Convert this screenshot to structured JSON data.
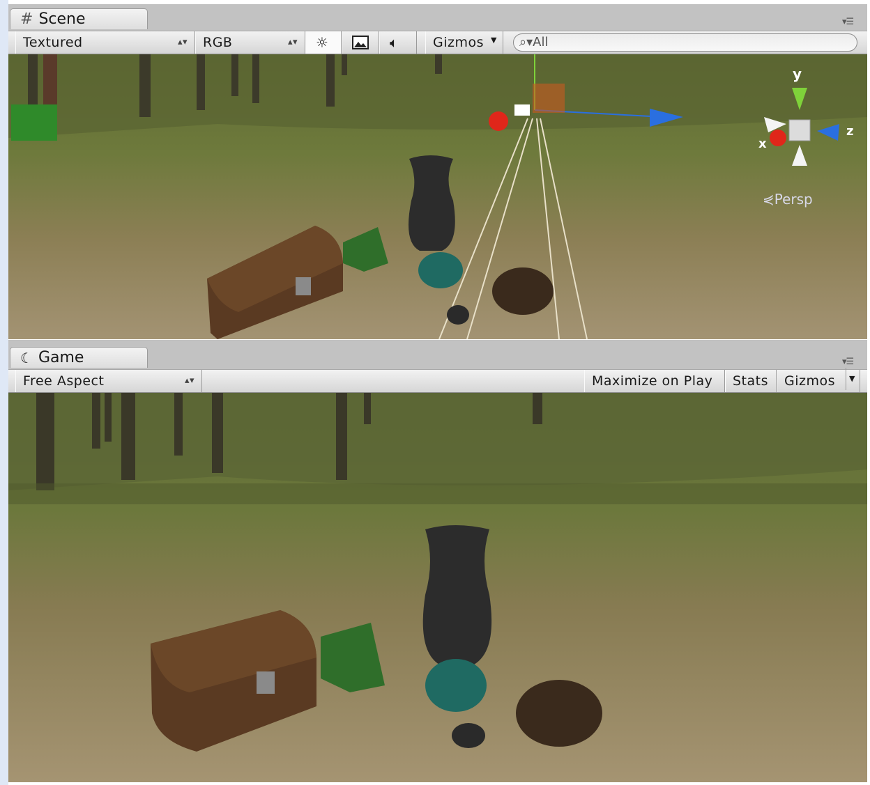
{
  "scene": {
    "tab_title": "Scene",
    "tab_icon": "scene-hash-icon",
    "draw_mode": "Textured",
    "render_mode": "RGB",
    "lighting_icon": "sun-icon",
    "image_icon": "image-icon",
    "audio_icon": "speaker-icon",
    "gizmos_label": "Gizmos",
    "search_placeholder": "All",
    "axis_labels": {
      "y": "y",
      "x": "x",
      "z": "z"
    },
    "projection_label": "Persp"
  },
  "game": {
    "tab_title": "Game",
    "tab_icon": "game-pacman-icon",
    "aspect": "Free Aspect",
    "maximize_label": "Maximize on Play",
    "stats_label": "Stats",
    "gizmos_label": "Gizmos"
  },
  "colors": {
    "grass": "#6f7a3a",
    "dirt": "#9c8a62",
    "axis_x": "#e0261a",
    "axis_y": "#7fd23a",
    "axis_z": "#2a6fe0"
  }
}
